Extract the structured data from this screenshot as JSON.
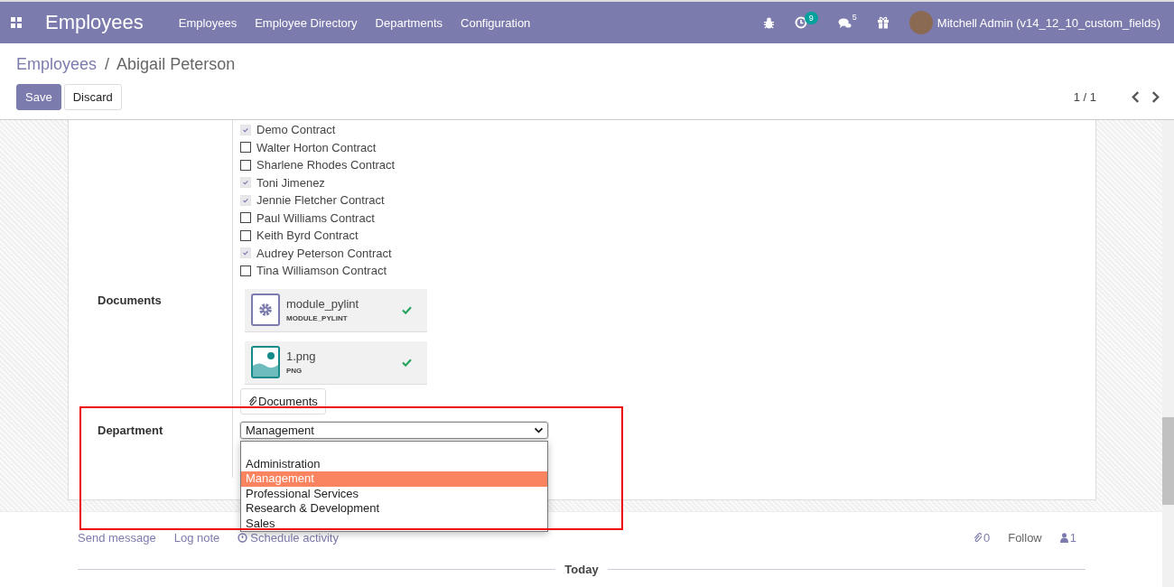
{
  "navbar": {
    "app_title": "Employees",
    "menu": [
      "Employees",
      "Employee Directory",
      "Departments",
      "Configuration"
    ],
    "activity_count": "9",
    "message_count": "5",
    "user": "Mitchell Admin (v14_12_10_custom_fields)"
  },
  "breadcrumb": {
    "parent": "Employees",
    "separator": "/",
    "current": "Abigail Peterson"
  },
  "buttons": {
    "save": "Save",
    "discard": "Discard"
  },
  "pager": "1 / 1",
  "contracts": [
    {
      "label": "Demo Contract",
      "checked": true
    },
    {
      "label": "Walter Horton Contract",
      "checked": false
    },
    {
      "label": "Sharlene Rhodes Contract",
      "checked": false
    },
    {
      "label": "Toni Jimenez",
      "checked": true
    },
    {
      "label": "Jennie Fletcher Contract",
      "checked": true
    },
    {
      "label": "Paul Williams Contract",
      "checked": false
    },
    {
      "label": "Keith Byrd Contract",
      "checked": false
    },
    {
      "label": "Audrey Peterson Contract",
      "checked": true
    },
    {
      "label": "Tina Williamson Contract",
      "checked": false
    }
  ],
  "documents": {
    "label": "Documents",
    "files": [
      {
        "name": "module_pylint",
        "ext": "MODULE_PYLINT",
        "kind": "module"
      },
      {
        "name": "1.png",
        "ext": "PNG",
        "kind": "image"
      }
    ],
    "button": "Documents"
  },
  "department": {
    "label": "Department",
    "value": "Management",
    "expanded": true,
    "options": [
      {
        "label": "Administration",
        "selected": false
      },
      {
        "label": "Management",
        "selected": true
      },
      {
        "label": "Professional Services",
        "selected": false
      },
      {
        "label": "Research & Development",
        "selected": false
      },
      {
        "label": "Sales",
        "selected": false
      }
    ]
  },
  "chatter": {
    "actions": [
      "Send message",
      "Log note",
      "Schedule activity"
    ],
    "attachments": "0",
    "follow": "Follow",
    "followers": "1",
    "divider": "Today"
  }
}
